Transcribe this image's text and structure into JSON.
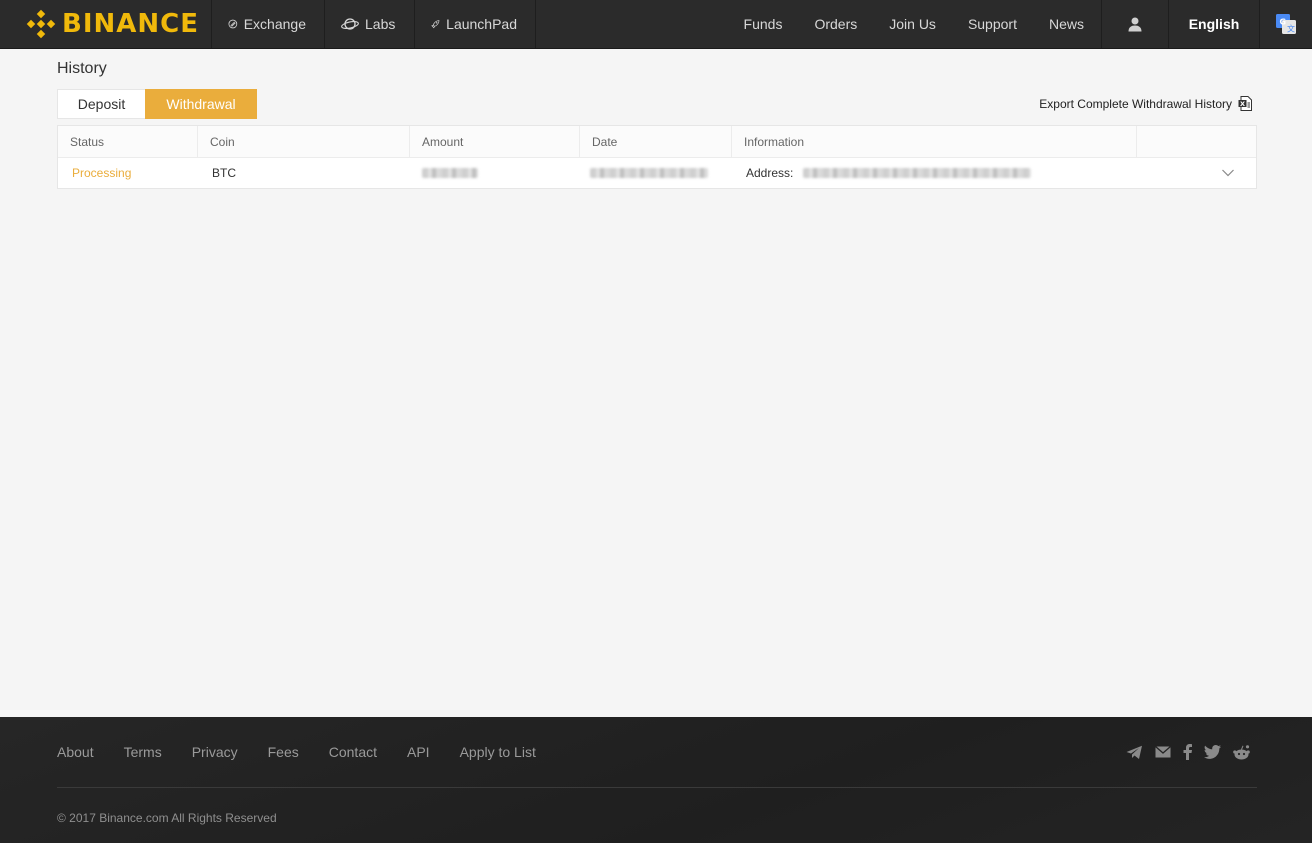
{
  "header": {
    "brand": "BINANCE",
    "nav_left": [
      {
        "label": "Exchange",
        "icon": "exchange-icon"
      },
      {
        "label": "Labs",
        "icon": "planet-icon"
      },
      {
        "label": "LaunchPad",
        "icon": "rocket-icon"
      }
    ],
    "nav_right": [
      "Funds",
      "Orders",
      "Join Us",
      "Support",
      "News"
    ],
    "language": "English"
  },
  "page": {
    "title": "History",
    "tabs": [
      {
        "label": "Deposit",
        "active": false
      },
      {
        "label": "Withdrawal",
        "active": true
      }
    ],
    "export_label": "Export Complete Withdrawal History"
  },
  "table": {
    "columns": [
      "Status",
      "Coin",
      "Amount",
      "Date",
      "Information",
      ""
    ],
    "rows": [
      {
        "status": "Processing",
        "coin": "BTC",
        "amount": "",
        "date": "",
        "info_label": "Address:",
        "address": ""
      }
    ]
  },
  "footer": {
    "links": [
      "About",
      "Terms",
      "Privacy",
      "Fees",
      "Contact",
      "API",
      "Apply to List"
    ],
    "social": [
      "telegram-icon",
      "mail-icon",
      "facebook-icon",
      "twitter-icon",
      "reddit-icon"
    ],
    "copyright": "© 2017 Binance.com All Rights Reserved"
  },
  "colors": {
    "brand": "#f0b90b",
    "accent": "#eaad3c",
    "header_bg": "#2b2b2b",
    "footer_bg": "#222222"
  }
}
